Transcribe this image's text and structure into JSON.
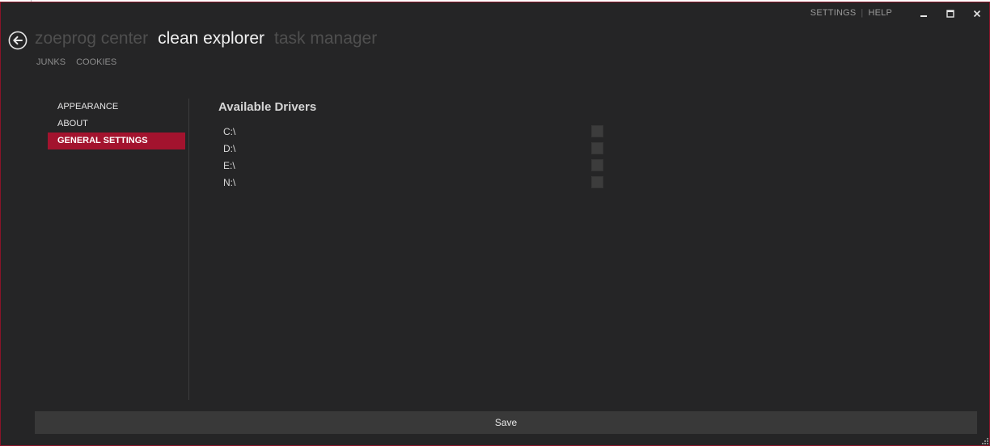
{
  "caption": {
    "settings_label": "SETTINGS",
    "separator": "|",
    "help_label": "HELP"
  },
  "header": {
    "titles": [
      {
        "label": "zoeprog center",
        "active": false
      },
      {
        "label": "clean explorer",
        "active": true
      },
      {
        "label": "task manager",
        "active": false
      }
    ],
    "sub_tabs": [
      {
        "label": "JUNKS"
      },
      {
        "label": "COOKIES"
      }
    ]
  },
  "settings_menu": {
    "items": [
      {
        "label": "APPEARANCE",
        "selected": false
      },
      {
        "label": "ABOUT",
        "selected": false
      },
      {
        "label": "GENERAL SETTINGS",
        "selected": true
      }
    ]
  },
  "drivers": {
    "title": "Available Drivers",
    "items": [
      {
        "label": "C:\\",
        "checked": false
      },
      {
        "label": "D:\\",
        "checked": false
      },
      {
        "label": "E:\\",
        "checked": false
      },
      {
        "label": "N:\\",
        "checked": false
      }
    ]
  },
  "footer": {
    "save_label": "Save"
  },
  "icons": {
    "back": "arrow-left-circle-icon",
    "minimize": "minimize-icon",
    "maximize": "maximize-icon",
    "close": "close-icon",
    "resize": "resize-grip-icon"
  },
  "colors": {
    "background": "#252526",
    "accent": "#a3132e",
    "border": "#8a1428",
    "active_title": "#f0f0f0",
    "inactive_title": "#4f4f4f",
    "button": "#393939"
  }
}
